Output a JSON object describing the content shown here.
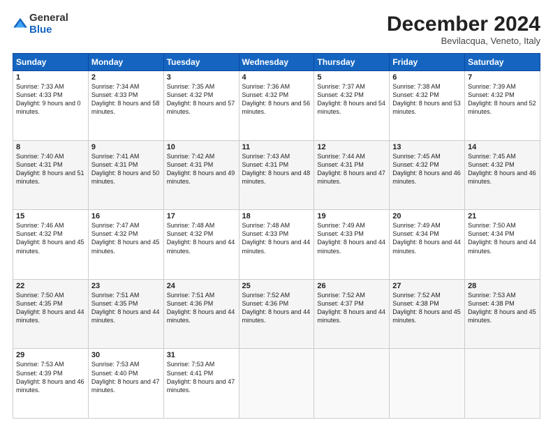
{
  "logo": {
    "general": "General",
    "blue": "Blue"
  },
  "header": {
    "month": "December 2024",
    "location": "Bevilacqua, Veneto, Italy"
  },
  "days": [
    "Sunday",
    "Monday",
    "Tuesday",
    "Wednesday",
    "Thursday",
    "Friday",
    "Saturday"
  ],
  "weeks": [
    [
      {
        "day": "1",
        "sunrise": "7:33 AM",
        "sunset": "4:33 PM",
        "daylight": "9 hours and 0 minutes."
      },
      {
        "day": "2",
        "sunrise": "7:34 AM",
        "sunset": "4:33 PM",
        "daylight": "8 hours and 58 minutes."
      },
      {
        "day": "3",
        "sunrise": "7:35 AM",
        "sunset": "4:32 PM",
        "daylight": "8 hours and 57 minutes."
      },
      {
        "day": "4",
        "sunrise": "7:36 AM",
        "sunset": "4:32 PM",
        "daylight": "8 hours and 56 minutes."
      },
      {
        "day": "5",
        "sunrise": "7:37 AM",
        "sunset": "4:32 PM",
        "daylight": "8 hours and 54 minutes."
      },
      {
        "day": "6",
        "sunrise": "7:38 AM",
        "sunset": "4:32 PM",
        "daylight": "8 hours and 53 minutes."
      },
      {
        "day": "7",
        "sunrise": "7:39 AM",
        "sunset": "4:32 PM",
        "daylight": "8 hours and 52 minutes."
      }
    ],
    [
      {
        "day": "8",
        "sunrise": "7:40 AM",
        "sunset": "4:31 PM",
        "daylight": "8 hours and 51 minutes."
      },
      {
        "day": "9",
        "sunrise": "7:41 AM",
        "sunset": "4:31 PM",
        "daylight": "8 hours and 50 minutes."
      },
      {
        "day": "10",
        "sunrise": "7:42 AM",
        "sunset": "4:31 PM",
        "daylight": "8 hours and 49 minutes."
      },
      {
        "day": "11",
        "sunrise": "7:43 AM",
        "sunset": "4:31 PM",
        "daylight": "8 hours and 48 minutes."
      },
      {
        "day": "12",
        "sunrise": "7:44 AM",
        "sunset": "4:31 PM",
        "daylight": "8 hours and 47 minutes."
      },
      {
        "day": "13",
        "sunrise": "7:45 AM",
        "sunset": "4:32 PM",
        "daylight": "8 hours and 46 minutes."
      },
      {
        "day": "14",
        "sunrise": "7:45 AM",
        "sunset": "4:32 PM",
        "daylight": "8 hours and 46 minutes."
      }
    ],
    [
      {
        "day": "15",
        "sunrise": "7:46 AM",
        "sunset": "4:32 PM",
        "daylight": "8 hours and 45 minutes."
      },
      {
        "day": "16",
        "sunrise": "7:47 AM",
        "sunset": "4:32 PM",
        "daylight": "8 hours and 45 minutes."
      },
      {
        "day": "17",
        "sunrise": "7:48 AM",
        "sunset": "4:32 PM",
        "daylight": "8 hours and 44 minutes."
      },
      {
        "day": "18",
        "sunrise": "7:48 AM",
        "sunset": "4:33 PM",
        "daylight": "8 hours and 44 minutes."
      },
      {
        "day": "19",
        "sunrise": "7:49 AM",
        "sunset": "4:33 PM",
        "daylight": "8 hours and 44 minutes."
      },
      {
        "day": "20",
        "sunrise": "7:49 AM",
        "sunset": "4:34 PM",
        "daylight": "8 hours and 44 minutes."
      },
      {
        "day": "21",
        "sunrise": "7:50 AM",
        "sunset": "4:34 PM",
        "daylight": "8 hours and 44 minutes."
      }
    ],
    [
      {
        "day": "22",
        "sunrise": "7:50 AM",
        "sunset": "4:35 PM",
        "daylight": "8 hours and 44 minutes."
      },
      {
        "day": "23",
        "sunrise": "7:51 AM",
        "sunset": "4:35 PM",
        "daylight": "8 hours and 44 minutes."
      },
      {
        "day": "24",
        "sunrise": "7:51 AM",
        "sunset": "4:36 PM",
        "daylight": "8 hours and 44 minutes."
      },
      {
        "day": "25",
        "sunrise": "7:52 AM",
        "sunset": "4:36 PM",
        "daylight": "8 hours and 44 minutes."
      },
      {
        "day": "26",
        "sunrise": "7:52 AM",
        "sunset": "4:37 PM",
        "daylight": "8 hours and 44 minutes."
      },
      {
        "day": "27",
        "sunrise": "7:52 AM",
        "sunset": "4:38 PM",
        "daylight": "8 hours and 45 minutes."
      },
      {
        "day": "28",
        "sunrise": "7:53 AM",
        "sunset": "4:38 PM",
        "daylight": "8 hours and 45 minutes."
      }
    ],
    [
      {
        "day": "29",
        "sunrise": "7:53 AM",
        "sunset": "4:39 PM",
        "daylight": "8 hours and 46 minutes."
      },
      {
        "day": "30",
        "sunrise": "7:53 AM",
        "sunset": "4:40 PM",
        "daylight": "8 hours and 47 minutes."
      },
      {
        "day": "31",
        "sunrise": "7:53 AM",
        "sunset": "4:41 PM",
        "daylight": "8 hours and 47 minutes."
      },
      null,
      null,
      null,
      null
    ]
  ]
}
